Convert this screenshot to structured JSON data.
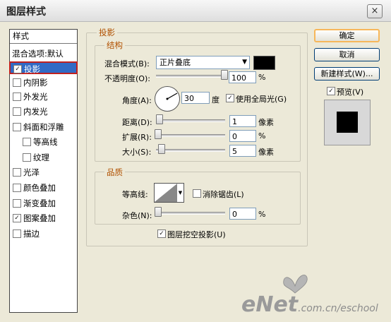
{
  "window": {
    "title": "图层样式",
    "close_glyph": "×"
  },
  "styles_panel": {
    "header": "样式",
    "items": [
      {
        "label": "混合选项:默认",
        "checkbox": false,
        "checked": false,
        "highlighted": false
      },
      {
        "label": "投影",
        "checkbox": true,
        "checked": true,
        "highlighted": true
      },
      {
        "label": "内阴影",
        "checkbox": true,
        "checked": false,
        "highlighted": false
      },
      {
        "label": "外发光",
        "checkbox": true,
        "checked": false,
        "highlighted": false
      },
      {
        "label": "内发光",
        "checkbox": true,
        "checked": false,
        "highlighted": false
      },
      {
        "label": "斜面和浮雕",
        "checkbox": true,
        "checked": false,
        "highlighted": false
      },
      {
        "label": "等高线",
        "checkbox": true,
        "checked": false,
        "highlighted": false,
        "sub": true
      },
      {
        "label": "纹理",
        "checkbox": true,
        "checked": false,
        "highlighted": false,
        "sub": true
      },
      {
        "label": "光泽",
        "checkbox": true,
        "checked": false,
        "highlighted": false
      },
      {
        "label": "颜色叠加",
        "checkbox": true,
        "checked": false,
        "highlighted": false
      },
      {
        "label": "渐变叠加",
        "checkbox": true,
        "checked": false,
        "highlighted": false
      },
      {
        "label": "图案叠加",
        "checkbox": true,
        "checked": true,
        "highlighted": false
      },
      {
        "label": "描边",
        "checkbox": true,
        "checked": false,
        "highlighted": false
      }
    ]
  },
  "drop_shadow": {
    "section_title": "投影",
    "structure": {
      "title": "结构",
      "blend_mode_label": "混合模式(B):",
      "blend_mode_value": "正片叠底",
      "shadow_color": "#000000",
      "opacity_label": "不透明度(O):",
      "opacity_value": "100",
      "opacity_unit": "%",
      "angle_label": "角度(A):",
      "angle_value": "30",
      "angle_unit": "度",
      "global_light_label": "使用全局光(G)",
      "global_light_checked": true,
      "distance_label": "距离(D):",
      "distance_value": "1",
      "distance_unit": "像素",
      "spread_label": "扩展(R):",
      "spread_value": "0",
      "spread_unit": "%",
      "size_label": "大小(S):",
      "size_value": "5",
      "size_unit": "像素"
    },
    "quality": {
      "title": "品质",
      "contour_label": "等高线:",
      "anti_alias_label": "消除锯齿(L)",
      "anti_alias_checked": false,
      "noise_label": "杂色(N):",
      "noise_value": "0",
      "noise_unit": "%"
    },
    "knockout_label": "图层挖空投影(U)",
    "knockout_checked": true
  },
  "buttons": {
    "ok": "确定",
    "cancel": "取消",
    "new_style": "新建样式(W)..."
  },
  "preview": {
    "label": "预览(V)",
    "checked": true
  },
  "watermark": {
    "brand": "eNet",
    "suffix": ".com.cn/eschool"
  }
}
